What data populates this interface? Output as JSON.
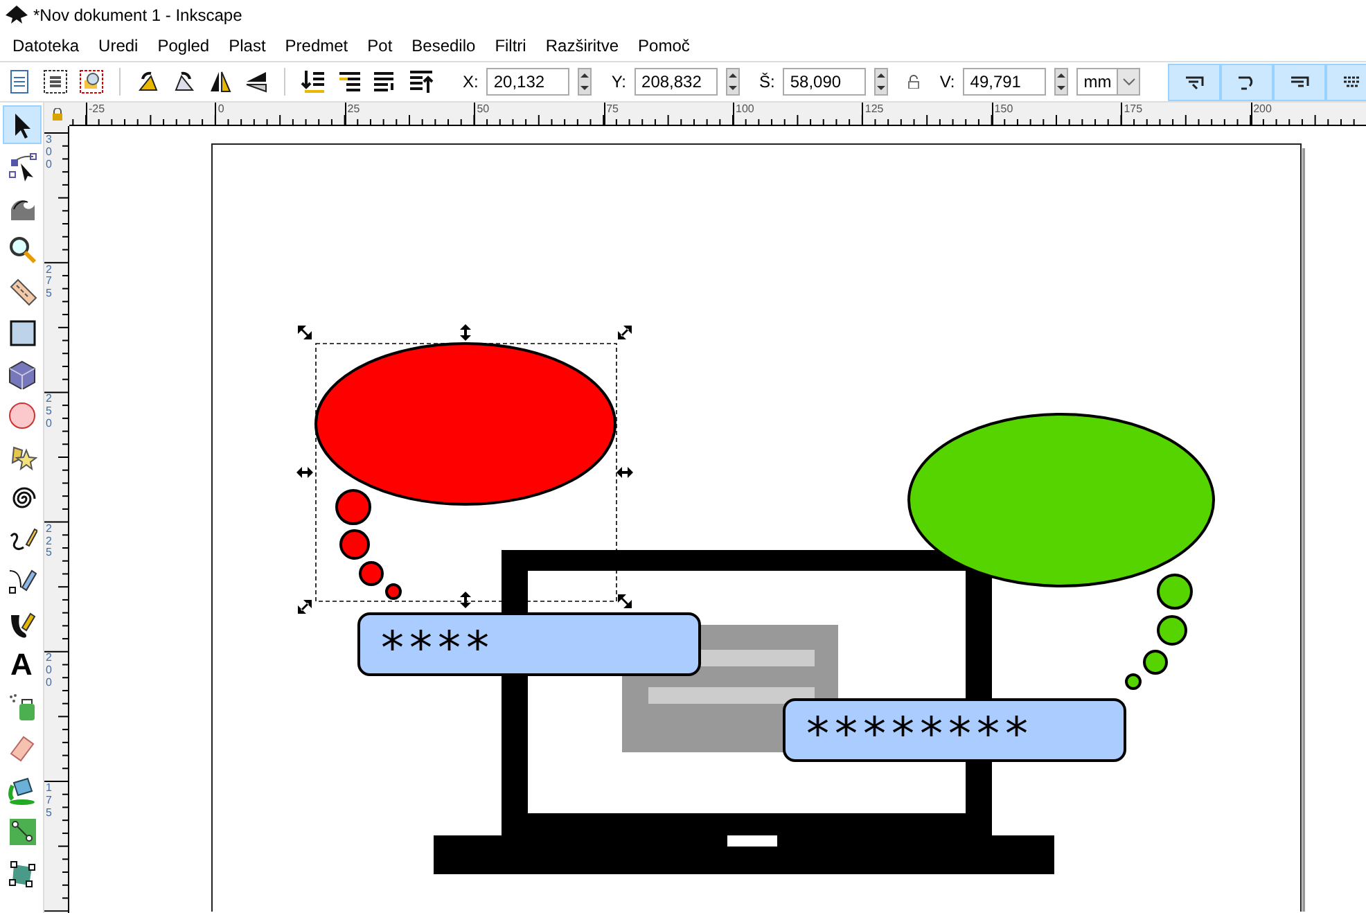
{
  "window": {
    "title": "*Nov dokument 1 - Inkscape"
  },
  "menu": [
    "Datoteka",
    "Uredi",
    "Pogled",
    "Plast",
    "Predmet",
    "Pot",
    "Besedilo",
    "Filtri",
    "Razširitve",
    "Pomoč"
  ],
  "toolbar": {
    "fields": [
      {
        "label": "X:",
        "value": "20,132"
      },
      {
        "label": "Y:",
        "value": "208,832"
      },
      {
        "label": "Š:",
        "value": "58,090"
      },
      {
        "label": "V:",
        "value": "49,791"
      }
    ],
    "unit": "mm",
    "snap_buttons": [
      {
        "on": true
      },
      {
        "on": true
      },
      {
        "on": true
      },
      {
        "on": true
      }
    ]
  },
  "ruler_horizontal": [
    "-25",
    "0",
    "25",
    "50",
    "75",
    "100",
    "125",
    "150",
    "175",
    "200"
  ],
  "ruler_vertical": [
    "300",
    "275",
    "250",
    "225",
    "200",
    "175"
  ],
  "tools": [
    {
      "selected": true
    },
    {
      "selected": false
    },
    {
      "selected": false
    },
    {
      "selected": false
    },
    {
      "selected": false
    },
    {
      "selected": false
    },
    {
      "selected": false
    },
    {
      "selected": false
    },
    {
      "selected": false
    },
    {
      "selected": false
    },
    {
      "selected": false
    },
    {
      "selected": false
    },
    {
      "selected": false
    },
    {
      "selected": false,
      "glyph": "A"
    },
    {
      "selected": false
    },
    {
      "selected": false
    },
    {
      "selected": false
    },
    {
      "selected": false
    },
    {
      "selected": false
    }
  ],
  "canvas": {
    "password_fields": [
      {
        "text": "****"
      },
      {
        "text": "********"
      }
    ]
  }
}
